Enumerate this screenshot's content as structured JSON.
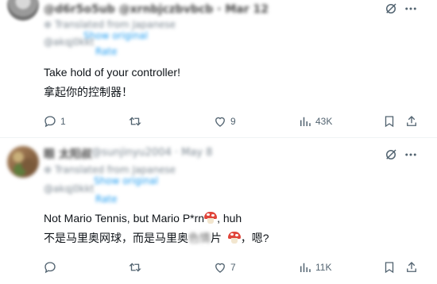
{
  "tweet1": {
    "header_blur": "@d6r5o5ub  @xrnbjczbvbcb  ·  Mar 12",
    "translated_blur": "⊕ Translated from Japanese",
    "show_original_blur": "Show original",
    "source_blur": "@akqj0kkt",
    "rate_blur": "Rate",
    "text_lines": [
      "Take hold of your controller!",
      "拿起你的控制器！"
    ],
    "actions": {
      "replies": "1",
      "reposts": "",
      "likes": "9",
      "views": "43K"
    }
  },
  "tweet2": {
    "name_blur": "眼 太阳叔",
    "handle_blur": "@sunjinyu2004 · May 8",
    "translated_blur": "⊕ Translated from Japanese",
    "show_original_blur": "Show original",
    "source_blur": "@akqj0kkt",
    "rate_blur": "Rate",
    "line1_a": "Not Mario Tennis, but Mario P*rn",
    "line1_b": ", huh",
    "line2_a": "不是马里奥网球，而是马里奥",
    "line2_censored": "色情",
    "line2_b": "片",
    "line2_c": "，嗯?",
    "actions": {
      "replies": "",
      "reposts": "",
      "likes": "7",
      "views": "11K"
    }
  },
  "icons": {
    "grok": "grok-icon",
    "more": "more-icon",
    "reply": "reply-icon",
    "repost": "repost-icon",
    "like": "heart-icon",
    "views": "views-icon",
    "bookmark": "bookmark-icon",
    "share": "share-icon",
    "emoji": "mushroom-emoji"
  },
  "colors": {
    "text": "#0f1419",
    "muted": "#536471",
    "link": "#1d9bf0",
    "divider": "#eff3f4"
  }
}
